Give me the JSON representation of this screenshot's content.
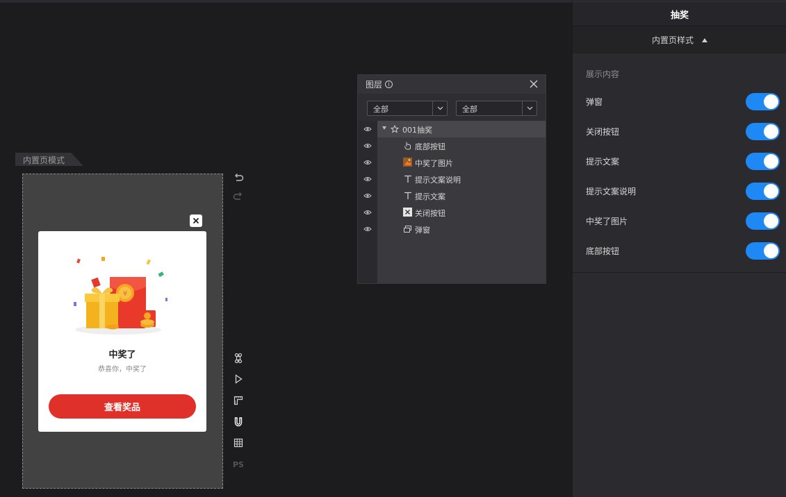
{
  "canvas": {
    "mode_label": "内置页模式",
    "popup": {
      "title": "中奖了",
      "subtitle": "恭喜你，中奖了",
      "button_label": "查看奖品"
    },
    "tools": [
      "undo-icon",
      "redo-icon",
      "command-icon",
      "play-icon",
      "ruler-icon",
      "magnet-icon",
      "grid-icon",
      "ps-icon"
    ],
    "ps_label": "PS"
  },
  "layers": {
    "title": "图层",
    "info_glyph": "i",
    "filter_1": "全部",
    "filter_2": "全部",
    "items": [
      {
        "label": "001抽奖",
        "icon": "star-icon"
      },
      {
        "label": "底部按钮",
        "icon": "pointer-icon"
      },
      {
        "label": "中奖了图片",
        "icon": "image-icon"
      },
      {
        "label": "提示文案说明",
        "icon": "text-icon"
      },
      {
        "label": "提示文案",
        "icon": "text-icon"
      },
      {
        "label": "关闭按钮",
        "icon": "close-box-icon"
      },
      {
        "label": "弹窗",
        "icon": "window-icon"
      }
    ]
  },
  "panel": {
    "title": "抽奖",
    "style_label": "内置页样式",
    "section_label": "展示内容",
    "toggles": [
      {
        "label": "弹窗",
        "on": true
      },
      {
        "label": "关闭按钮",
        "on": true
      },
      {
        "label": "提示文案",
        "on": true
      },
      {
        "label": "提示文案说明",
        "on": true
      },
      {
        "label": "中奖了图片",
        "on": true
      },
      {
        "label": "底部按钮",
        "on": true
      }
    ],
    "accent_color": "#1e88f5"
  }
}
